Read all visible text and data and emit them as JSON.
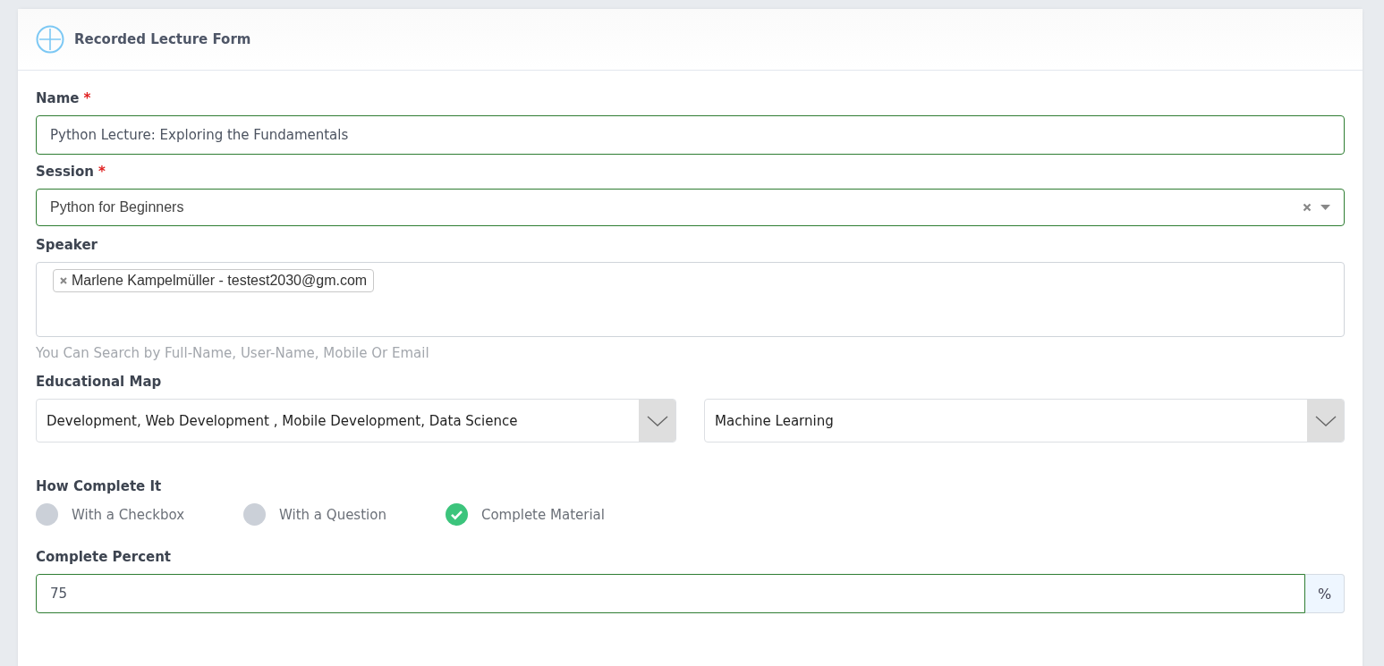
{
  "card": {
    "title": "Recorded Lecture Form"
  },
  "fields": [
    {
      "kind": "text",
      "label": "Name",
      "required_mark": "*",
      "valid": true,
      "value": "Python Lecture: Exploring the Fundamentals"
    },
    {
      "kind": "select",
      "label": "Session",
      "required_mark": "*",
      "valid": true,
      "value": "Python for Beginners"
    },
    {
      "kind": "tags",
      "label": "Speaker",
      "valid": false,
      "tags": [
        "Marlene Kampelmüller - testest2030@gm.com"
      ],
      "hint": "You Can Search by Full-Name, User-Name, Mobile Or Email"
    },
    {
      "kind": "dropdowns",
      "label": "Educational Map",
      "values": [
        "Development, Web Development , Mobile Development, Data Science",
        "Machine Learning"
      ]
    },
    {
      "kind": "radio",
      "label": "How Complete It",
      "options": [
        {
          "label": "With a Checkbox",
          "selected": false
        },
        {
          "label": "With a Question",
          "selected": false
        },
        {
          "label": "Complete Material",
          "selected": true
        }
      ]
    },
    {
      "kind": "addon",
      "label": "Complete Percent",
      "valid": true,
      "value": "75",
      "addon": "%"
    }
  ]
}
